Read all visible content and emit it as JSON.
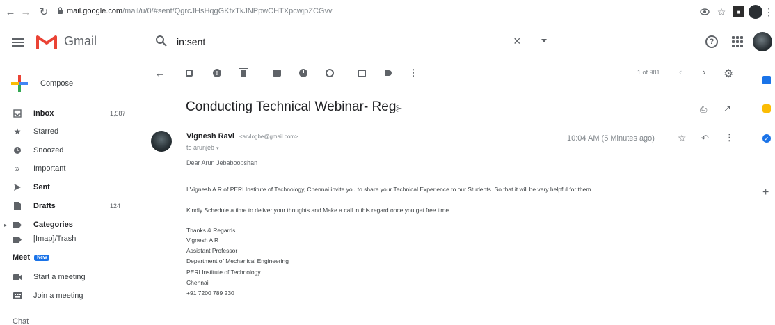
{
  "browser": {
    "url_host": "mail.google.com",
    "url_path": "/mail/u/0/#sent/QgrcJHsHqgGKfxTkJNPpwCHTXpcwjpZCGvv"
  },
  "header": {
    "app_name": "Gmail",
    "search_value": "in:sent"
  },
  "sidebar": {
    "compose_label": "Compose",
    "items": [
      {
        "label": "Inbox",
        "count": "1,587",
        "bold": true,
        "icon": "inbox-icon"
      },
      {
        "label": "Starred",
        "count": "",
        "bold": false,
        "icon": "star-icon"
      },
      {
        "label": "Snoozed",
        "count": "",
        "bold": false,
        "icon": "clock-icon"
      },
      {
        "label": "Important",
        "count": "",
        "bold": false,
        "icon": "important-icon"
      },
      {
        "label": "Sent",
        "count": "",
        "bold": true,
        "icon": "send-icon"
      },
      {
        "label": "Drafts",
        "count": "124",
        "bold": true,
        "icon": "draft-icon"
      },
      {
        "label": "Categories",
        "count": "",
        "bold": true,
        "icon": "label-icon"
      },
      {
        "label": "[Imap]/Trash",
        "count": "",
        "bold": false,
        "icon": "label-icon"
      }
    ],
    "meet": {
      "heading": "Meet",
      "badge": "New",
      "items": [
        {
          "label": "Start a meeting",
          "icon": "video-icon"
        },
        {
          "label": "Join a meeting",
          "icon": "keyboard-icon"
        }
      ]
    },
    "chat_heading": "Chat"
  },
  "toolbar": {
    "pagination": "1 of 981"
  },
  "message": {
    "subject": "Conducting Technical Webinar- Reg",
    "sender_name": "Vignesh Ravi",
    "sender_email": "<arvlogbe@gmail.com>",
    "to_line": "to arunjeb",
    "time": "10:04 AM (5 Minutes ago)",
    "body": [
      "Dear Arun Jebaboopshan",
      "I Vignesh A R of PERI Institute of Technology, Chennai invite you to share your Technical Experience to our Students. So that it will be very helpful for them",
      "Kindly Schedule a time to deliver your thoughts and Make a call in this regard once you get free time",
      "Thanks & Regards",
      "Vignesh A R",
      "Assistant Professor",
      "Department of Mechanical Engineering",
      "PERI Institute of Technology",
      "Chennai",
      "+91 7200 789 230"
    ]
  },
  "colors": {
    "accent_blue": "#1a73e8",
    "gmail_red": "#ea4335",
    "keep_yellow": "#fbbc04"
  }
}
